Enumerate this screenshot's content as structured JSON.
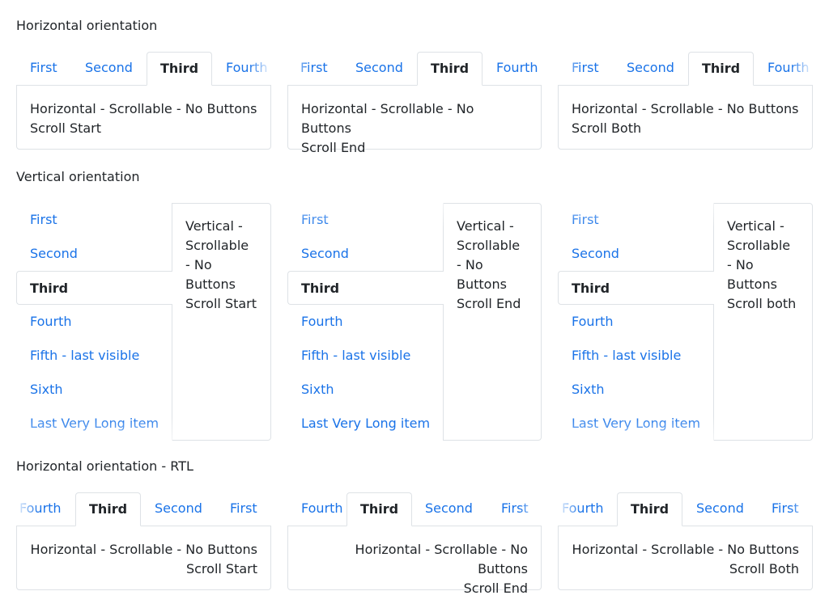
{
  "sections": {
    "horizontal": "Horizontal orientation",
    "vertical": "Vertical orientation",
    "rtl": "Horizontal orientation - RTL"
  },
  "tabs": {
    "first": "First",
    "second": "Second",
    "third": "Third",
    "fourth": "Fourth",
    "fifth": "Fifth - last visible",
    "sixth": "Sixth",
    "last": "Last Very Long item"
  },
  "horizontal": [
    {
      "line1": "Horizontal - Scrollable - No Buttons",
      "line2": "Scroll Start"
    },
    {
      "line1": "Horizontal - Scrollable - No Buttons",
      "line2": "Scroll End"
    },
    {
      "line1": "Horizontal - Scrollable - No Buttons",
      "line2": "Scroll Both"
    }
  ],
  "vertical": [
    {
      "l1": "Vertical -",
      "l2": "Scrollable",
      "l3": "- No",
      "l4": "Buttons",
      "l5": "Scroll Start"
    },
    {
      "l1": "Vertical -",
      "l2": "Scrollable",
      "l3": "- No",
      "l4": "Buttons",
      "l5": "Scroll End"
    },
    {
      "l1": "Vertical -",
      "l2": "Scrollable",
      "l3": "- No",
      "l4": "Buttons",
      "l5": "Scroll both"
    }
  ],
  "rtl": [
    {
      "line1": "Horizontal - Scrollable - No Buttons",
      "line2": "Scroll Start"
    },
    {
      "line1": "Horizontal - Scrollable - No Buttons",
      "line2": "Scroll End"
    },
    {
      "line1": "Horizontal - Scrollable - No Buttons",
      "line2": "Scroll Both"
    }
  ],
  "colors": {
    "link": "#1a73e8",
    "text": "#212529",
    "border": "#dee2e6"
  }
}
